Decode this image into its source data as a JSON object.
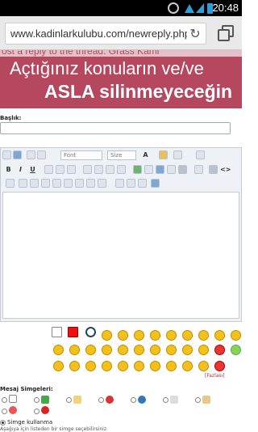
{
  "statusbar": {
    "time": "20:48"
  },
  "browser": {
    "url": "www.kadinlarkulubu.com/newreply.php",
    "reload_icon": "reload-icon",
    "tabs_icon": "tabs-icon"
  },
  "banner": {
    "top_strip_text": "ost a reply to the thread: Grass Kami",
    "line1": "Açtığınız konuların ve/ve",
    "line2": "ASLA silinmeyeceğin"
  },
  "form": {
    "title_label": "Başlık:",
    "title_value": ""
  },
  "editor": {
    "font_select": "Font",
    "size_select": "Size",
    "bold": "B",
    "italic": "I",
    "underline": "U",
    "font_color": "A"
  },
  "smilies": {
    "more_link": "[Fazlası]"
  },
  "message_icons": {
    "label": "Mesaj Simgeleri:",
    "no_icon_label": "Simge kullanma",
    "note": "Aşağıya için listeden bir simge seçebilirsiniz"
  }
}
